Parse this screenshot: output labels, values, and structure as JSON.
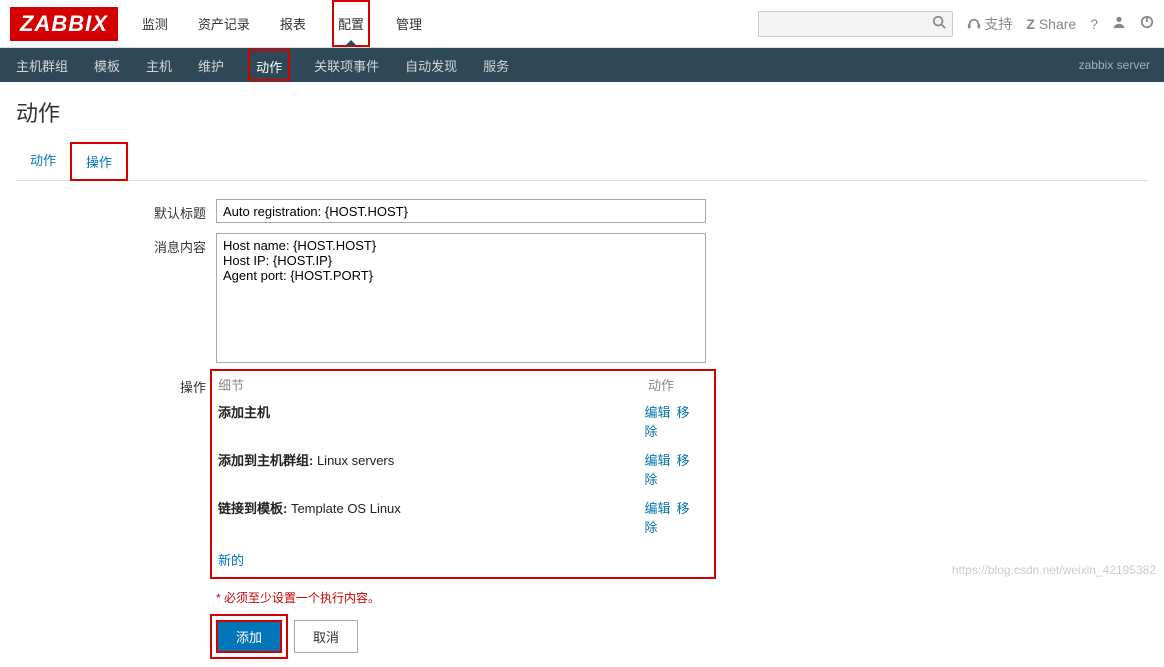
{
  "logo": "ZABBIX",
  "topnav": {
    "items": [
      "监测",
      "资产记录",
      "报表",
      "配置",
      "管理"
    ],
    "activeIndex": 3
  },
  "topright": {
    "support": "支持",
    "share": "Share"
  },
  "subnav": {
    "items": [
      "主机群组",
      "模板",
      "主机",
      "维护",
      "动作",
      "关联项事件",
      "自动发现",
      "服务"
    ],
    "activeIndex": 4,
    "right": "zabbix server"
  },
  "page": {
    "title": "动作"
  },
  "tabs": {
    "items": [
      "动作",
      "操作"
    ],
    "activeIndex": 1
  },
  "form": {
    "defaultTitle": {
      "label": "默认标题",
      "value": "Auto registration: {HOST.HOST}"
    },
    "message": {
      "label": "消息内容",
      "value": "Host name: {HOST.HOST}\nHost IP: {HOST.IP}\nAgent port: {HOST.PORT}"
    },
    "ops": {
      "label": "操作",
      "headDetail": "细节",
      "headAction": "动作",
      "rows": [
        {
          "detailBold": "添加主机",
          "detailVal": "",
          "edit": "编辑",
          "remove": "移除"
        },
        {
          "detailBold": "添加到主机群组:",
          "detailVal": " Linux servers",
          "edit": "编辑",
          "remove": "移除"
        },
        {
          "detailBold": "链接到模板:",
          "detailVal": " Template OS Linux",
          "edit": "编辑",
          "remove": "移除"
        }
      ],
      "newLabel": "新的"
    },
    "required": "* 必须至少设置一个执行内容。",
    "submit": "添加",
    "cancel": "取消"
  },
  "watermark": "https://blog.csdn.net/weixin_42195382"
}
